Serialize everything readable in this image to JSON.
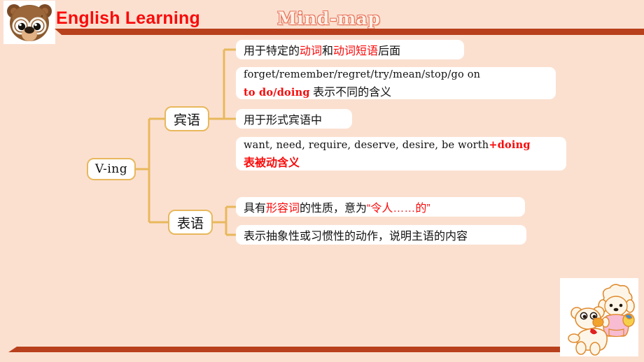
{
  "header": {
    "mascot_icon": "bear-face-with-glasses-icon",
    "course_title": "English Learning",
    "deck_title": "Mind-map"
  },
  "footer": {
    "corner_art_icon": "bear-and-sheep-costume-cartoon-icon"
  },
  "colors": {
    "background": "#fbe0d0",
    "rule_brick": "#b8401c",
    "accent_red": "#fa0a0a",
    "node_border_gold": "#e8b85c",
    "connector_gold": "#e8b85c",
    "node_fill": "#ffffff",
    "title_outline": "#e8705a"
  },
  "mindmap": {
    "root": {
      "label": "V-ing"
    },
    "branches": [
      {
        "label": "宾语",
        "leaves": [
          {
            "name": "leaf-verbs",
            "lines": [
              [
                {
                  "text": "用于特定的",
                  "style": "cn"
                },
                {
                  "text": "动词",
                  "style": "cn red"
                },
                {
                  "text": "和",
                  "style": "cn"
                },
                {
                  "text": "动词短语",
                  "style": "cn red"
                },
                {
                  "text": "后面",
                  "style": "cn"
                }
              ]
            ]
          },
          {
            "name": "leaf-verblist",
            "lines": [
              [
                {
                  "text": "forget/remember/regret/try/mean/stop/go on",
                  "style": "mono"
                }
              ],
              [
                {
                  "text": "to do/doing",
                  "style": "mono red-b"
                },
                {
                  "text": " 表示不同的含义",
                  "style": "cn"
                }
              ]
            ]
          },
          {
            "name": "leaf-formal",
            "lines": [
              [
                {
                  "text": "用于形式宾语中",
                  "style": "cn"
                }
              ]
            ]
          },
          {
            "name": "leaf-passivelist",
            "lines": [
              [
                {
                  "text": "want, need, require, deserve, desire, be worth",
                  "style": "mono"
                },
                {
                  "text": "+doing",
                  "style": "mono red-b"
                }
              ],
              [
                {
                  "text": "表被动含义",
                  "style": "cn red-b"
                }
              ]
            ]
          }
        ]
      },
      {
        "label": "表语",
        "leaves": [
          {
            "name": "leaf-adjective",
            "lines": [
              [
                {
                  "text": "具有",
                  "style": "cn"
                },
                {
                  "text": "形容词",
                  "style": "cn red"
                },
                {
                  "text": "的性质，意为",
                  "style": "cn"
                },
                {
                  "text": "“令人……的”",
                  "style": "cn red"
                }
              ]
            ]
          },
          {
            "name": "leaf-abstract",
            "lines": [
              [
                {
                  "text": "表示抽象性或习惯性的动作，说明主语的内容",
                  "style": "cn"
                }
              ]
            ]
          }
        ]
      }
    ]
  }
}
